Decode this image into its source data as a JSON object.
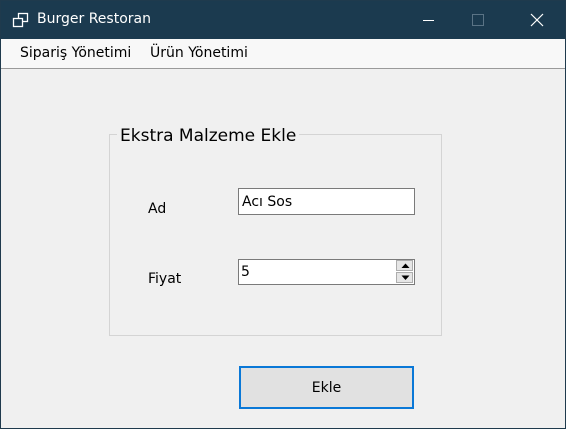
{
  "window": {
    "title": "Burger Restoran",
    "app_icon": "window-cascade-icon",
    "controls": [
      "minimize-icon",
      "maximize-icon",
      "close-icon"
    ]
  },
  "menu": {
    "items": [
      {
        "label": "Sipariş Yönetimi"
      },
      {
        "label": "Ürün Yönetimi"
      }
    ]
  },
  "form": {
    "group_title": "Ekstra Malzeme Ekle",
    "ad_label": "Ad",
    "ad_value": "Acı Sos",
    "fiyat_label": "Fiyat",
    "fiyat_value": "5",
    "submit_label": "Ekle"
  },
  "colors": {
    "titlebar": "#1b3a4f",
    "window_bg": "#f0f0f0",
    "button_focus_border": "#0a78d7"
  }
}
